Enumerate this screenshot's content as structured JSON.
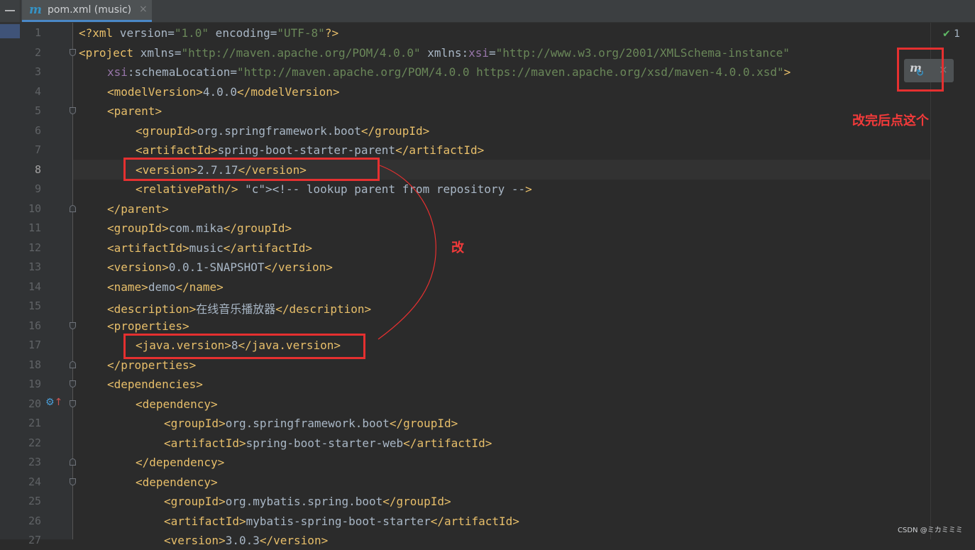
{
  "tab": {
    "icon": "maven-m-icon",
    "label": "pom.xml (music)",
    "close": "×"
  },
  "inspections": {
    "count": "1"
  },
  "maven_reload": {
    "icon": "maven-reload-icon",
    "close": "×"
  },
  "annotations": {
    "reload_hint": "改完后点这个",
    "change": "改"
  },
  "watermark": "CSDN @ミカミミミ",
  "colors": {
    "tag": "#e8bf6a",
    "attr_value": "#6a8759",
    "namespace": "#9876aa",
    "comment": "#808080",
    "text": "#a9b7c6",
    "annotation": "#e53030"
  },
  "lines": [
    {
      "n": "1",
      "text": "<?xml version=\"1.0\" encoding=\"UTF-8\"?>"
    },
    {
      "n": "2",
      "text": "<project xmlns=\"http://maven.apache.org/POM/4.0.0\" xmlns:xsi=\"http://www.w3.org/2001/XMLSchema-instance\""
    },
    {
      "n": "3",
      "text": "xsi:schemaLocation=\"http://maven.apache.org/POM/4.0.0 https://maven.apache.org/xsd/maven-4.0.0.xsd\">"
    },
    {
      "n": "4",
      "text": "<modelVersion>4.0.0</modelVersion>"
    },
    {
      "n": "5",
      "text": "<parent>"
    },
    {
      "n": "6",
      "text": "<groupId>org.springframework.boot</groupId>"
    },
    {
      "n": "7",
      "text": "<artifactId>spring-boot-starter-parent</artifactId>"
    },
    {
      "n": "8",
      "text": "<version>2.7.17</version>"
    },
    {
      "n": "9",
      "text": "<relativePath/> <!-- lookup parent from repository -->"
    },
    {
      "n": "10",
      "text": "</parent>"
    },
    {
      "n": "11",
      "text": "<groupId>com.mika</groupId>"
    },
    {
      "n": "12",
      "text": "<artifactId>music</artifactId>"
    },
    {
      "n": "13",
      "text": "<version>0.0.1-SNAPSHOT</version>"
    },
    {
      "n": "14",
      "text": "<name>demo</name>"
    },
    {
      "n": "15",
      "text": "<description>在线音乐播放器</description>"
    },
    {
      "n": "16",
      "text": "<properties>"
    },
    {
      "n": "17",
      "text": "<java.version>8</java.version>"
    },
    {
      "n": "18",
      "text": "</properties>"
    },
    {
      "n": "19",
      "text": "<dependencies>"
    },
    {
      "n": "20",
      "text": "<dependency>"
    },
    {
      "n": "21",
      "text": "<groupId>org.springframework.boot</groupId>"
    },
    {
      "n": "22",
      "text": "<artifactId>spring-boot-starter-web</artifactId>"
    },
    {
      "n": "23",
      "text": "</dependency>"
    },
    {
      "n": "24",
      "text": "<dependency>"
    },
    {
      "n": "25",
      "text": "<groupId>org.mybatis.spring.boot</groupId>"
    },
    {
      "n": "26",
      "text": "<artifactId>mybatis-spring-boot-starter</artifactId>"
    },
    {
      "n": "27",
      "text": "<version>3.0.3</version>"
    }
  ]
}
